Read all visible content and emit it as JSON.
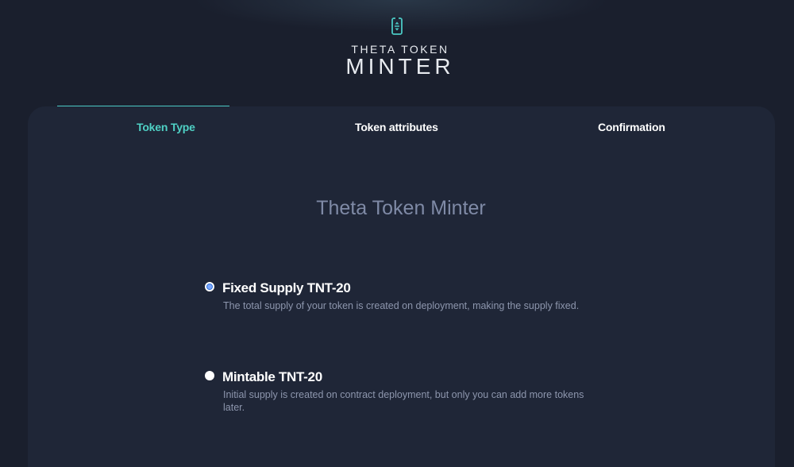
{
  "logo": {
    "icon": "theta-token-icon",
    "line1": "THETA TOKEN",
    "line2": "MINTER",
    "color": "#4bc9c4"
  },
  "tabs": [
    {
      "label": "Token Type",
      "active": true
    },
    {
      "label": "Token attributes",
      "active": false
    },
    {
      "label": "Confirmation",
      "active": false
    }
  ],
  "main": {
    "heading": "Theta Token Minter",
    "options": [
      {
        "title": "Fixed Supply TNT-20",
        "description": "The total supply of your token is created on deployment, making the supply fixed.",
        "selected": true
      },
      {
        "title": "Mintable TNT-20",
        "description": "Initial supply is created on contract deployment, but only you can add more tokens later.",
        "selected": false
      }
    ]
  },
  "colors": {
    "background": "#1a1f2d",
    "card": "#1f2637",
    "accent": "#4fd1c5",
    "radio_selected": "#2d6fd6"
  }
}
